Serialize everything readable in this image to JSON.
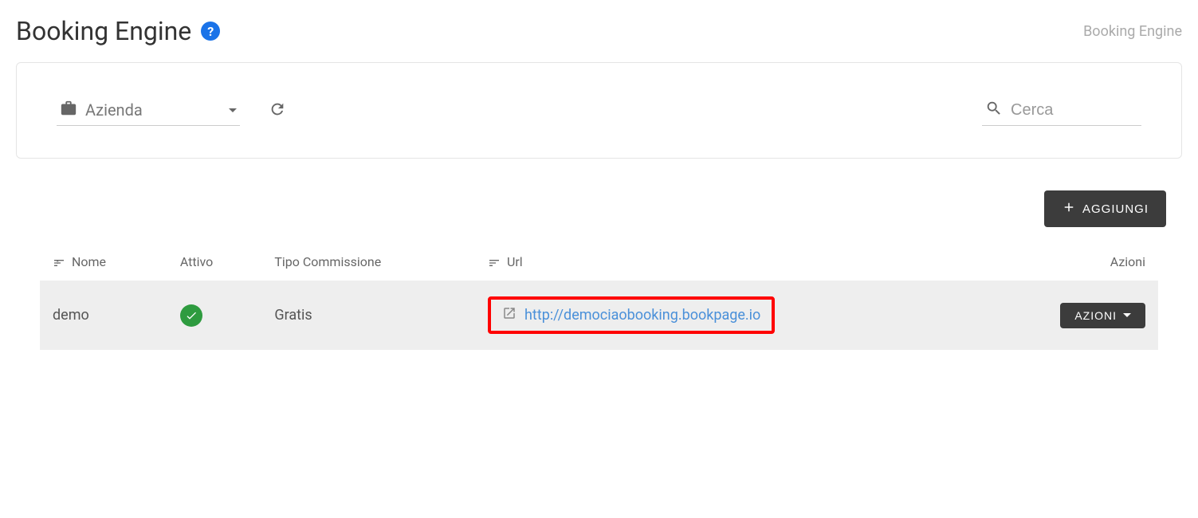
{
  "header": {
    "title": "Booking Engine",
    "breadcrumb": "Booking Engine"
  },
  "filter": {
    "company_label": "Azienda",
    "search_placeholder": "Cerca"
  },
  "add_button": "AGGIUNGI",
  "table": {
    "columns": {
      "name": "Nome",
      "active": "Attivo",
      "commission_type": "Tipo Commissione",
      "url": "Url",
      "actions": "Azioni"
    },
    "rows": [
      {
        "name": "demo",
        "active": true,
        "commission_type": "Gratis",
        "url": "http://demociaobooking.bookpage.io",
        "actions_label": "AZIONI"
      }
    ]
  }
}
